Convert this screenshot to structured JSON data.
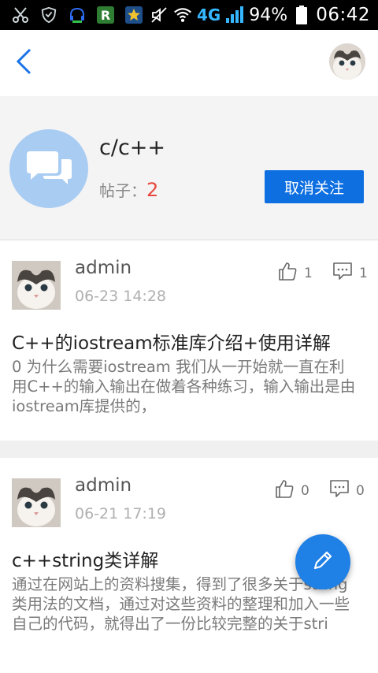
{
  "status_bar": {
    "network": "4G",
    "battery_percent": "94%",
    "time": "06:42",
    "left_icons": [
      "scissors-icon",
      "shield-icon",
      "headset-icon",
      "r-app-icon",
      "star-app-icon"
    ],
    "right_icons": [
      "mute-icon",
      "wifi-icon",
      "signal-icon",
      "battery-icon"
    ]
  },
  "top_bar": {
    "back_icon": "chevron-left-icon",
    "avatar": "user-avatar"
  },
  "forum": {
    "name": "c/c++",
    "posts_label": "帖子：",
    "posts_count": "2",
    "unfollow_label": "取消关注",
    "icon": "chat-bubbles-icon",
    "icon_color": "#a9ccf3"
  },
  "posts": [
    {
      "author": "admin",
      "time": "06-23 14:28",
      "likes": "1",
      "comments": "1",
      "title": "C++的iostream标准库介绍+使用详解",
      "excerpt": "0 为什么需要iostream 我们从一开始就一直在利用C++的输入输出在做着各种练习，输入输出是由iostream库提供的，"
    },
    {
      "author": "admin",
      "time": "06-21 17:19",
      "likes": "0",
      "comments": "0",
      "title": "c++string类详解",
      "excerpt": "通过在网站上的资料搜集，得到了很多关于string类用法的文档，通过对这些资料的整理和加入一些自己的代码，就得出了一份比较完整的关于stri"
    }
  ],
  "fab": {
    "icon": "pencil-icon",
    "color": "#1f80e6"
  },
  "colors": {
    "accent": "#0d6fe0",
    "count_red": "#e8473f"
  }
}
